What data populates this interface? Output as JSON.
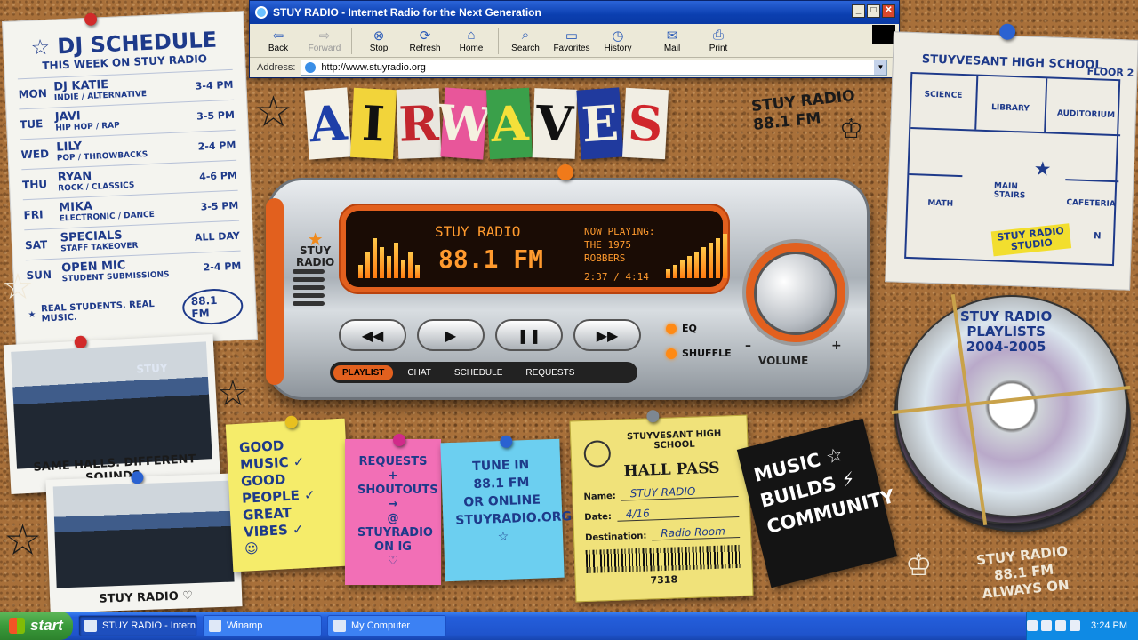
{
  "browser": {
    "title": "STUY RADIO - Internet Radio for the Next Generation",
    "toolbar": [
      {
        "label": "Back",
        "icon": "back-arrow-icon",
        "glyph": "⇦",
        "enabled": true
      },
      {
        "label": "Forward",
        "icon": "forward-arrow-icon",
        "glyph": "⇨",
        "enabled": false
      },
      {
        "label": "Stop",
        "icon": "stop-icon",
        "glyph": "⊗",
        "enabled": true
      },
      {
        "label": "Refresh",
        "icon": "refresh-icon",
        "glyph": "⟳",
        "enabled": true
      },
      {
        "label": "Home",
        "icon": "home-icon",
        "glyph": "⌂",
        "enabled": true
      },
      {
        "label": "Search",
        "icon": "search-icon",
        "glyph": "⌕",
        "enabled": true
      },
      {
        "label": "Favorites",
        "icon": "favorites-folder-icon",
        "glyph": "▭",
        "enabled": true
      },
      {
        "label": "History",
        "icon": "history-clock-icon",
        "glyph": "◷",
        "enabled": true
      },
      {
        "label": "Mail",
        "icon": "mail-icon",
        "glyph": "✉",
        "enabled": true
      },
      {
        "label": "Print",
        "icon": "print-icon",
        "glyph": "⎙",
        "enabled": true
      }
    ],
    "address_label": "Address:",
    "url": "http://www.stuyradio.org"
  },
  "schedule": {
    "title": "DJ SCHEDULE",
    "subtitle": "THIS WEEK ON STUY RADIO",
    "rows": [
      {
        "day": "MON",
        "dj": "DJ KATIE",
        "genre": "INDIE / ALTERNATIVE",
        "time": "3-4 PM"
      },
      {
        "day": "TUE",
        "dj": "JAVI",
        "genre": "HIP HOP / RAP",
        "time": "3-5 PM"
      },
      {
        "day": "WED",
        "dj": "LILY",
        "genre": "POP / THROWBACKS",
        "time": "2-4 PM"
      },
      {
        "day": "THU",
        "dj": "RYAN",
        "genre": "ROCK / CLASSICS",
        "time": "4-6 PM"
      },
      {
        "day": "FRI",
        "dj": "MIKA",
        "genre": "ELECTRONIC / DANCE",
        "time": "3-5 PM"
      },
      {
        "day": "SAT",
        "dj": "SPECIALS",
        "genre": "STAFF TAKEOVER",
        "time": "ALL DAY"
      },
      {
        "day": "SUN",
        "dj": "OPEN MIC",
        "genre": "STUDENT SUBMISSIONS",
        "time": "2-4 PM"
      }
    ],
    "footer": "REAL STUDENTS. REAL MUSIC.",
    "freq_badge": "88.1 FM"
  },
  "headline": {
    "letters": [
      {
        "ch": "A",
        "bg": "#f4f1e6",
        "fg": "#1e3fa8"
      },
      {
        "ch": "I",
        "bg": "#f2d43a",
        "fg": "#111111"
      },
      {
        "ch": "R",
        "bg": "#e9e6df",
        "fg": "#c2262e"
      },
      {
        "ch": "W",
        "bg": "#e8569a",
        "fg": "#f5f1e0"
      },
      {
        "ch": "A",
        "bg": "#3aa04a",
        "fg": "#f4e03a"
      },
      {
        "ch": "V",
        "bg": "#f1eee4",
        "fg": "#111111"
      },
      {
        "ch": "E",
        "bg": "#203a9e",
        "fg": "#f5f1e0"
      },
      {
        "ch": "S",
        "bg": "#f1eee4",
        "fg": "#d0262c"
      }
    ]
  },
  "doodles": {
    "stuy_fm": "STUY RADIO\n88.1 FM",
    "crown": "♔",
    "bottom_right": "STUY RADIO\n88.1 FM\nALWAYS ON"
  },
  "radio": {
    "brand": "STUY\nRADIO",
    "station": "STUY RADIO",
    "frequency": "88.1 FM",
    "now_playing_label": "NOW PLAYING:",
    "artist": "THE 1975",
    "track": "ROBBERS",
    "elapsed": "2:37",
    "duration": "4:14",
    "eq_left": [
      0.3,
      0.6,
      0.9,
      0.7,
      0.5,
      0.8,
      0.4,
      0.6,
      0.3
    ],
    "eq_right": [
      0.2,
      0.3,
      0.4,
      0.5,
      0.6,
      0.7,
      0.8,
      0.9,
      1.0
    ],
    "controls": [
      {
        "name": "rewind-button",
        "glyph": "◀◀"
      },
      {
        "name": "play-button",
        "glyph": "▶"
      },
      {
        "name": "pause-button",
        "glyph": "❚❚"
      },
      {
        "name": "fast-forward-button",
        "glyph": "▶▶"
      }
    ],
    "eq_label": "EQ",
    "shuffle_label": "SHUFFLE",
    "volume_label": "VOLUME",
    "volume_minus": "–",
    "volume_plus": "+",
    "tabs": [
      "PLAYLIST",
      "CHAT",
      "SCHEDULE",
      "REQUESTS"
    ],
    "active_tab": "PLAYLIST",
    "accent": "#e2601e"
  },
  "floorplan": {
    "title": "STUYVESANT HIGH SCHOOL",
    "floor": "FLOOR 2",
    "rooms": [
      "SCIENCE",
      "LIBRARY",
      "AUDITORIUM",
      "MATH",
      "MAIN\nSTAIRS",
      "CAFETERIA"
    ],
    "studio": "STUY RADIO\nSTUDIO",
    "north": "N"
  },
  "cds": {
    "label": "STUY RADIO\nPLAYLISTS\n2004-2005"
  },
  "photos": [
    {
      "caption": "SAME HALLS. DIFFERENT SOUNDS.",
      "sign": "STUY"
    },
    {
      "caption": "STUY RADIO ♡"
    }
  ],
  "stickies": {
    "yellow": [
      "GOOD MUSIC ✓",
      "GOOD PEOPLE ✓",
      "GREAT VIBES ✓",
      "☺"
    ],
    "pink": [
      "REQUESTS",
      "+",
      "SHOUTOUTS",
      "→",
      "@ STUYRADIO",
      "ON IG",
      "♡"
    ],
    "blue": [
      "TUNE IN",
      "88.1 FM",
      "OR ONLINE",
      "STUYRADIO.ORG",
      "☆"
    ]
  },
  "hallpass": {
    "school": "STUYVESANT HIGH SCHOOL",
    "title": "HALL PASS",
    "fields": [
      {
        "label": "Name:",
        "value": "STUY RADIO"
      },
      {
        "label": "Date:",
        "value": "4/16"
      },
      {
        "label": "Destination:",
        "value": "Radio Room"
      }
    ],
    "number": "7318"
  },
  "blackcard": {
    "lines": [
      "MUSIC ☆",
      "BUILDS ⚡",
      "COMMUNITY"
    ]
  },
  "taskbar": {
    "start": "start",
    "tasks": [
      {
        "label": "STUY RADIO - Internet...",
        "active": true
      },
      {
        "label": "Winamp",
        "active": false
      },
      {
        "label": "My Computer",
        "active": false
      }
    ],
    "clock": "3:24 PM"
  }
}
